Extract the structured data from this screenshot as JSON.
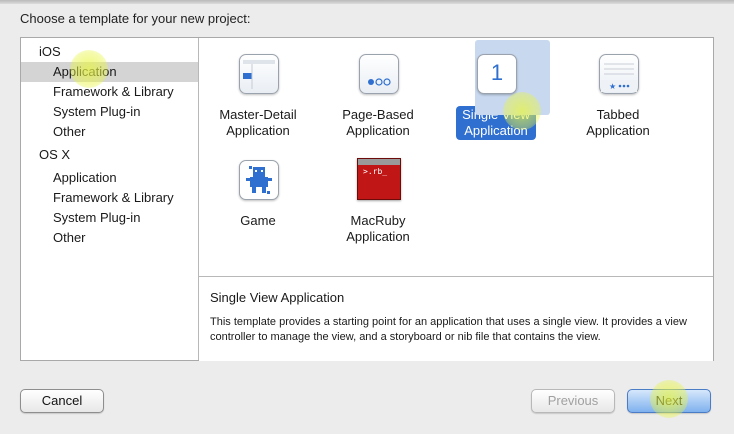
{
  "dialog": {
    "heading": "Choose a template for your new project:"
  },
  "sidebar": {
    "sections": [
      {
        "label": "iOS",
        "items": [
          {
            "label": "Application",
            "selected": true
          },
          {
            "label": "Framework & Library"
          },
          {
            "label": "System Plug-in"
          },
          {
            "label": "Other"
          }
        ]
      },
      {
        "label": "OS X",
        "items": [
          {
            "label": "Application"
          },
          {
            "label": "Framework & Library"
          },
          {
            "label": "System Plug-in"
          },
          {
            "label": "Other"
          }
        ]
      }
    ]
  },
  "templates": [
    {
      "label": "Master-Detail\nApplication",
      "icon": "master-detail-icon"
    },
    {
      "label": "Page-Based\nApplication",
      "icon": "page-based-icon"
    },
    {
      "label": "Single View\nApplication",
      "icon": "single-view-icon",
      "icon_text": "1",
      "selected": true
    },
    {
      "label": "Tabbed\nApplication",
      "icon": "tabbed-icon"
    },
    {
      "label": "Game",
      "icon": "game-icon"
    },
    {
      "label": "MacRuby\nApplication",
      "icon": "macruby-icon",
      "icon_text": ">.rb_"
    }
  ],
  "description": {
    "title": "Single View Application",
    "text": "This template provides a starting point for an application that uses a single view. It provides a view controller to manage the view, and a storyboard or nib file that contains the view."
  },
  "buttons": {
    "cancel": "Cancel",
    "previous": "Previous",
    "next": "Next"
  },
  "colors": {
    "selection_blue": "#2f6fd0",
    "sidebar_selected": "#d4d4d4",
    "highlight_yellow": "#e8f546"
  }
}
